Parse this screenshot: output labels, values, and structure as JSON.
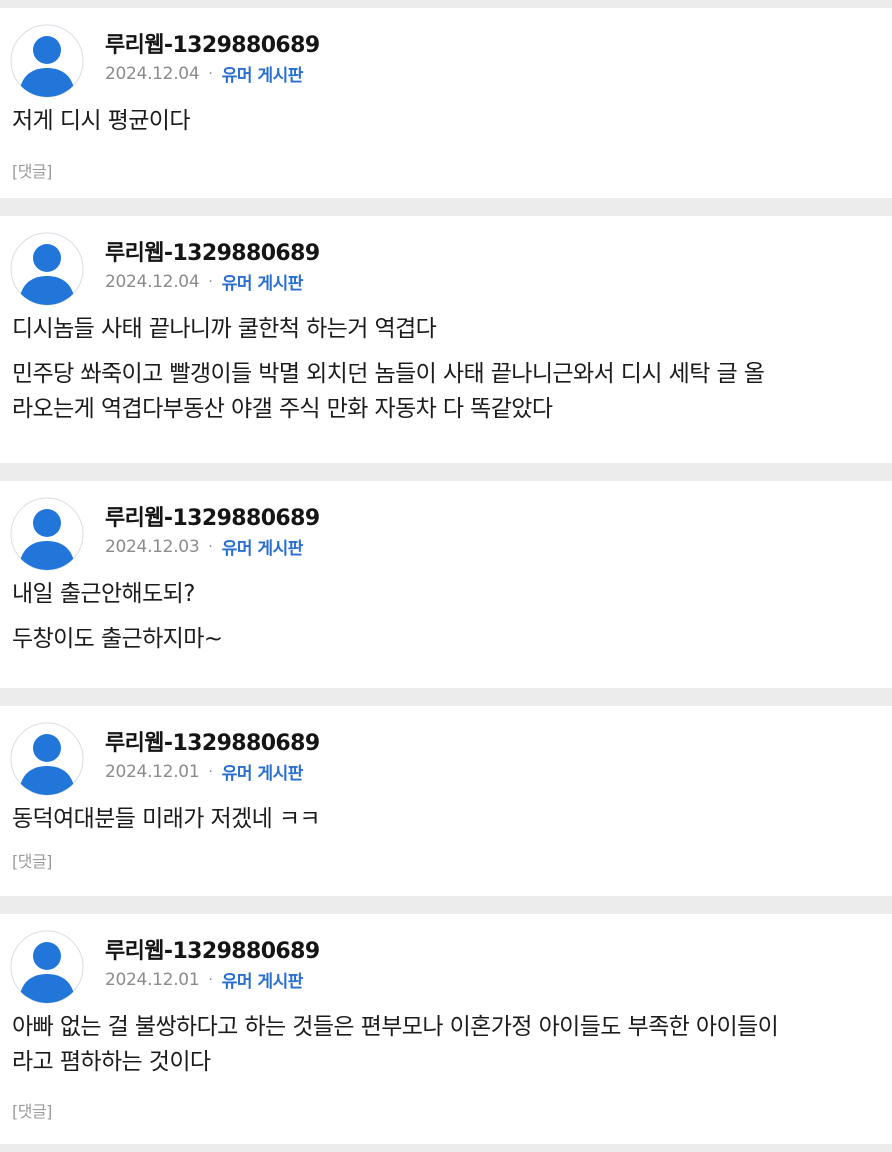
{
  "colors": {
    "background": "#ececec",
    "card": "#ffffff",
    "accent": "#2a6fd0",
    "avatar": "#2275d9",
    "muted": "#8b8b8b"
  },
  "avatar_icon": "user-silhouette-icon",
  "posts": [
    {
      "author": "루리웹-1329880689",
      "date": "2024.12.04",
      "separator": "·",
      "board": "유머 게시판",
      "lines": [
        "저게 디시 평균이다"
      ],
      "lines2": [],
      "reply_label": "[댓글]"
    },
    {
      "author": "루리웹-1329880689",
      "date": "2024.12.04",
      "separator": "·",
      "board": "유머 게시판",
      "lines": [
        "디시놈들 사태 끝나니까 쿨한척 하는거 역겹다"
      ],
      "lines2": [
        "민주당 쏴죽이고 빨갱이들 박멸 외치던 놈들이 사태 끝나니근와서 디시 세탁 글 올",
        "라오는게 역겹다부동산 야갤 주식 만화 자동차 다 똑같았다"
      ],
      "reply_label": ""
    },
    {
      "author": "루리웹-1329880689",
      "date": "2024.12.03",
      "separator": "·",
      "board": "유머 게시판",
      "lines": [
        "내일 출근안해도되?"
      ],
      "lines2": [
        "두창이도 출근하지마~"
      ],
      "reply_label": ""
    },
    {
      "author": "루리웹-1329880689",
      "date": "2024.12.01",
      "separator": "·",
      "board": "유머 게시판",
      "lines": [
        "동덕여대분들 미래가 저겠네 ㅋㅋ"
      ],
      "lines2": [],
      "reply_label": "[댓글]"
    },
    {
      "author": "루리웹-1329880689",
      "date": "2024.12.01",
      "separator": "·",
      "board": "유머 게시판",
      "lines": [
        "아빠 없는 걸 불쌍하다고 하는 것들은 편부모나 이혼가정 아이들도 부족한 아이들이",
        "라고 폄하하는 것이다"
      ],
      "lines2": [],
      "reply_label": "[댓글]"
    }
  ]
}
